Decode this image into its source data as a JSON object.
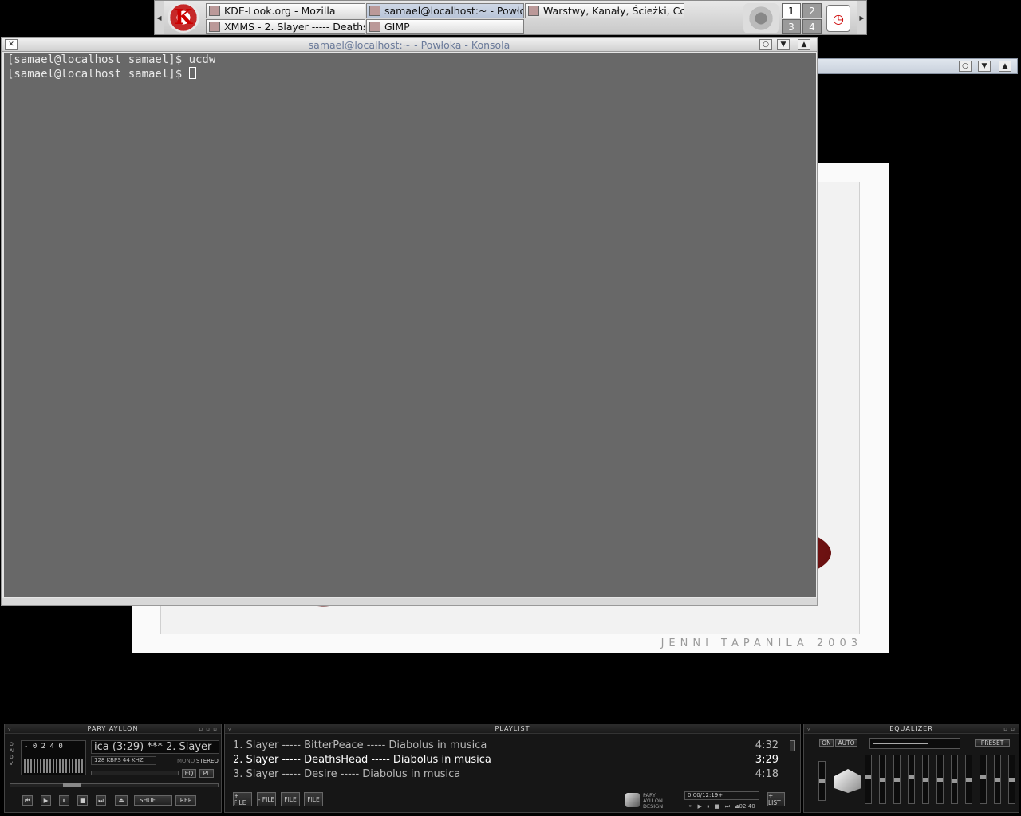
{
  "panel": {
    "kmenu_icon": "kde-gear-icon",
    "tasks": [
      {
        "label": "KDE-Look.org - Mozilla",
        "icon": "mozilla-icon"
      },
      {
        "label": "samael@localhost:~ - Powłoka",
        "icon": "konsole-icon"
      },
      {
        "label": "Warstwy, Kanały, Ścieżki, Co",
        "icon": "gimp-icon"
      },
      {
        "label": "XMMS - 2. Slayer ----- Deaths",
        "icon": "xmms-icon"
      },
      {
        "label": "GIMP",
        "icon": "gimp-icon"
      }
    ],
    "desktops": [
      "1",
      "2",
      "3",
      "4"
    ]
  },
  "konsole": {
    "title": "samael@localhost:~ - Powłoka - Konsola",
    "lines": [
      "[samael@localhost samael]$ ucdw",
      "[samael@localhost samael]$ "
    ]
  },
  "wallpaper": {
    "credit": "JENNI TAPANILA 2003"
  },
  "xmms": {
    "main_title": "PARY AYLLON",
    "vis_label": "OAIDV",
    "time": "- 0 2 4 0",
    "scroll_text": "ica (3:29)  ***  2. Slayer",
    "bitrate": "128 KBPS  44 KHZ",
    "mono": "MONO",
    "stereo": "STEREO",
    "eq_btn": "EQ",
    "pl_btn": "PL",
    "shuf_btn": "SHUF .....",
    "rep_btn": "REP"
  },
  "playlist": {
    "title": "PLAYLIST",
    "items": [
      {
        "text": "1. Slayer ----- BitterPeace ----- Diabolus in musica",
        "time": "4:32"
      },
      {
        "text": "2. Slayer ----- DeathsHead ----- Diabolus in musica",
        "time": "3:29",
        "current": true
      },
      {
        "text": "3. Slayer ----- Desire ----- Diabolus in musica",
        "time": "4:18"
      }
    ],
    "add_label": "+ FILE",
    "rem_label": "- FILE",
    "sel_label": "FILE",
    "misc_label": "FILE",
    "brand": "PARY AYLLON DESIGN",
    "pos_time": "0:00/12:19+",
    "remaining": "-02:40",
    "list_label": "+ LIST"
  },
  "equalizer": {
    "title": "EQUALIZER",
    "on": "ON",
    "auto": "AUTO",
    "preset": "PRESET",
    "bands": [
      0.5,
      0.55,
      0.5,
      0.5,
      0.55,
      0.5,
      0.5,
      0.45,
      0.5,
      0.55,
      0.5,
      0.5,
      0.5
    ]
  }
}
